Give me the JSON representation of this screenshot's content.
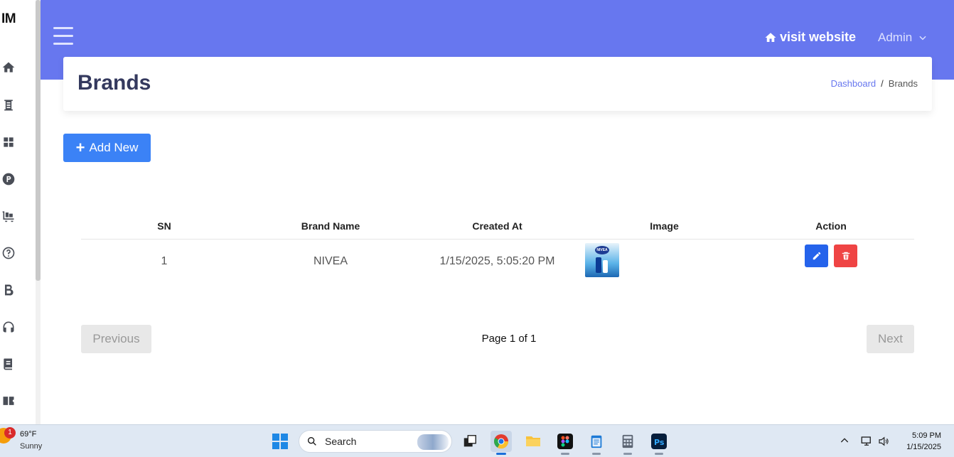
{
  "sidebar": {
    "brand": "IM",
    "items": [
      "home-icon",
      "monument-icon",
      "grid-icon",
      "product-p-icon",
      "cart-dolly-icon",
      "help-icon",
      "bold-b-icon",
      "headset-icon",
      "book-icon",
      "ticket-icon"
    ]
  },
  "topbar": {
    "visit_label": "visit website",
    "admin_label": "Admin"
  },
  "header": {
    "title": "Brands",
    "breadcrumb_home": "Dashboard",
    "breadcrumb_sep": "/",
    "breadcrumb_current": "Brands"
  },
  "toolbar": {
    "add_plus": "+",
    "add_label": "Add New"
  },
  "table": {
    "columns": [
      "SN",
      "Brand Name",
      "Created At",
      "Image",
      "Action"
    ],
    "rows": [
      {
        "sn": "1",
        "name": "NIVEA",
        "created": "1/15/2025, 5:05:20 PM",
        "thumb_logo": "NIVEA"
      }
    ]
  },
  "pagination": {
    "prev_label": "Previous",
    "info": "Page 1 of 1",
    "next_label": "Next"
  },
  "taskbar": {
    "weather_badge": "1",
    "temp": "69°F",
    "condition": "Sunny",
    "search_placeholder": "Search",
    "time": "5:09 PM",
    "date": "1/15/2025"
  },
  "colors": {
    "topbar": "#6777ef",
    "primary": "#3b82f6",
    "edit": "#2563eb",
    "delete": "#ef4444"
  }
}
